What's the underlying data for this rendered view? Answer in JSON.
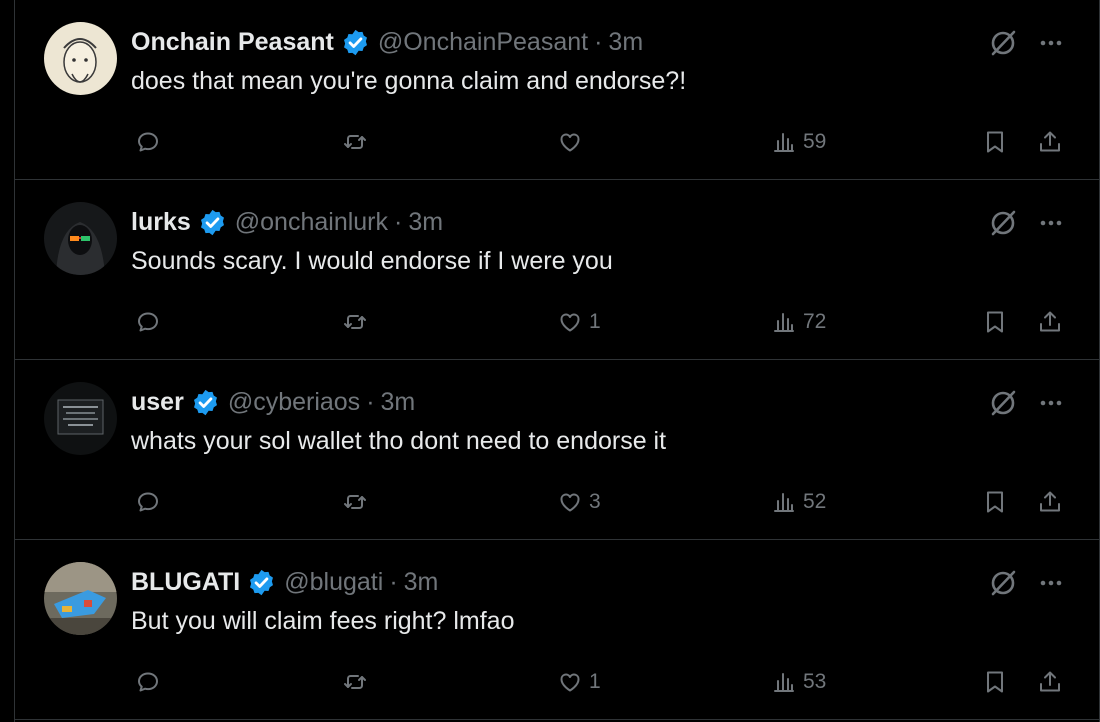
{
  "replies": [
    {
      "name": "Onchain Peasant",
      "handle": "@OnchainPeasant",
      "dot": "·",
      "time": "3m",
      "text": "does that mean you're gonna claim and endorse?!",
      "likes": "",
      "views": "59",
      "avatar": "ink-portrait-avatar"
    },
    {
      "name": "lurks",
      "handle": "@onchainlurk",
      "dot": "·",
      "time": "3m",
      "text": "Sounds scary. I would endorse if I were you",
      "likes": "1",
      "views": "72",
      "avatar": "hooded-figure-avatar"
    },
    {
      "name": "user",
      "handle": "@cyberiaos",
      "dot": "·",
      "time": "3m",
      "text": "whats your sol wallet tho dont need to endorse it",
      "likes": "3",
      "views": "52",
      "avatar": "terminal-avatar"
    },
    {
      "name": "BLUGATI",
      "handle": "@blugati",
      "dot": "·",
      "time": "3m",
      "text": "But you will claim fees right? lmfao",
      "likes": "1",
      "views": "53",
      "avatar": "toy-photo-avatar"
    }
  ],
  "colors": {
    "background": "#000000",
    "text": "#e7e9ea",
    "muted": "#71767b",
    "verified": "#1d9bf0",
    "divider": "#2f3336"
  }
}
